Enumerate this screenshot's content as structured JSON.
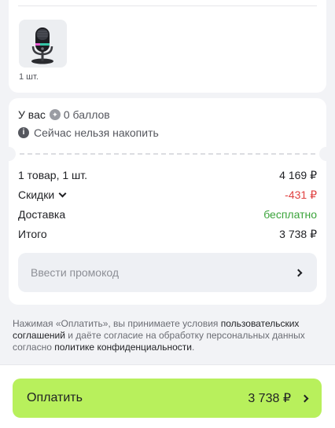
{
  "product": {
    "image_alt": "microphone",
    "quantity": "1 шт."
  },
  "points": {
    "prefix": "У вас",
    "balance": "0 баллов",
    "notice": "Сейчас нельзя накопить"
  },
  "summary": {
    "items_label": "1 товар, 1 шт.",
    "items_value": "4 169 ₽",
    "discount_label": "Скидки",
    "discount_value": "-431 ₽",
    "delivery_label": "Доставка",
    "delivery_value": "бесплатно",
    "total_label": "Итого",
    "total_value": "3 738 ₽"
  },
  "promo": {
    "label": "Ввести промокод"
  },
  "legal": {
    "part1": "Нажимая «Оплатить», вы принимаете условия ",
    "link1": "пользовательских соглашений",
    "part2": " и даёте согласие на обработку персональных данных согласно ",
    "link2": "политике конфиденциальности",
    "part3": "."
  },
  "pay": {
    "label": "Оплатить",
    "amount": "3 738 ₽"
  },
  "colors": {
    "accent_button": "#b8f05c",
    "discount": "#e04141",
    "free_delivery": "#3aa33a"
  }
}
